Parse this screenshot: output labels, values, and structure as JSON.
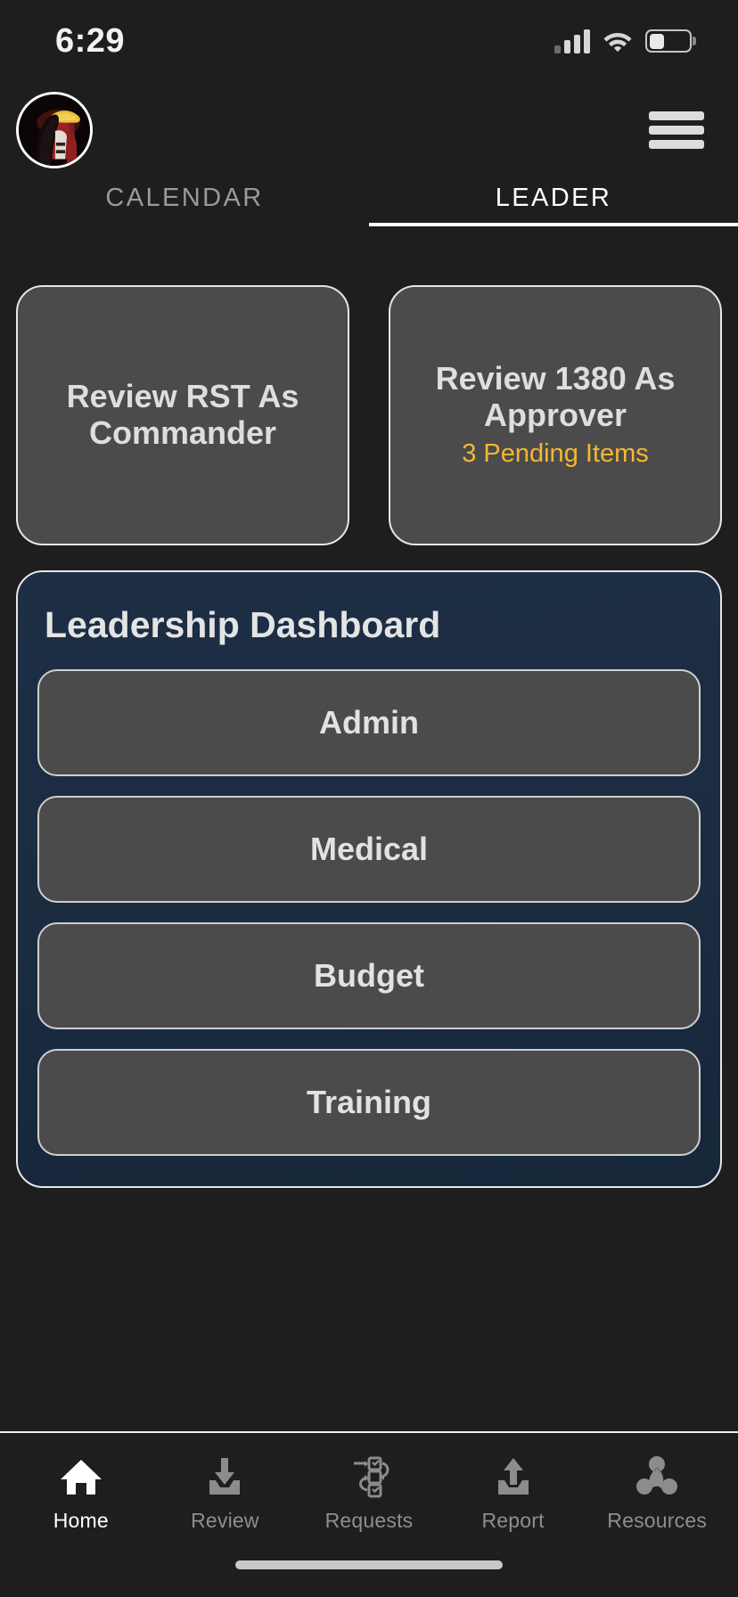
{
  "status_bar": {
    "time": "6:29",
    "signal_icon": "cellular-signal-icon",
    "wifi_icon": "wifi-icon",
    "battery_icon": "battery-icon",
    "battery_level_percent": 38
  },
  "header": {
    "avatar": "user-avatar",
    "menu_icon": "hamburger-menu-icon"
  },
  "tabs": [
    {
      "label": "CALENDAR",
      "active": false
    },
    {
      "label": "LEADER",
      "active": true
    }
  ],
  "quick_actions": [
    {
      "title": "Review RST As Commander",
      "subtitle": ""
    },
    {
      "title": "Review 1380 As Approver",
      "subtitle": "3 Pending Items"
    }
  ],
  "dashboard": {
    "title": "Leadership Dashboard",
    "buttons": [
      {
        "label": "Admin"
      },
      {
        "label": "Medical"
      },
      {
        "label": "Budget"
      },
      {
        "label": "Training"
      }
    ]
  },
  "bottom_nav": [
    {
      "label": "Home",
      "icon": "home-icon",
      "active": true
    },
    {
      "label": "Review",
      "icon": "inbox-download-icon",
      "active": false
    },
    {
      "label": "Requests",
      "icon": "workflow-icon",
      "active": false
    },
    {
      "label": "Report",
      "icon": "inbox-upload-icon",
      "active": false
    },
    {
      "label": "Resources",
      "icon": "resources-recycle-icon",
      "active": false
    }
  ],
  "colors": {
    "background": "#1e1e1e",
    "card": "#4b4b4b",
    "card_border": "#e6e6e6",
    "dashboard_bg": "#1d2e45",
    "accent_amber": "#f5b731",
    "text_primary": "#e2e2e2",
    "text_muted": "#8e8e8e"
  }
}
